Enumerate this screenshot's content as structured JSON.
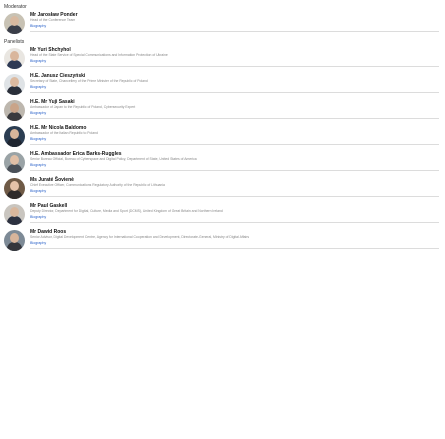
{
  "moderator": {
    "label": "Moderator",
    "entry": {
      "name": "Mr Jarosław Ponder",
      "desc": "Head of the Conference Team",
      "link": "Biography",
      "colors": {
        "bg": "#c8c2b4",
        "face": "#d8b9a0",
        "body": "#3b3f4a"
      }
    }
  },
  "panelists": {
    "label": "Panelists",
    "entries": [
      {
        "name": "Mr Yuri Shchyhol",
        "desc": "Head of the State Service of Special Communications and Information Protection of Ukraine",
        "link": "Biography",
        "colors": {
          "bg": "#e9e6e1",
          "face": "#d9b69c",
          "body": "#2e3a55"
        }
      },
      {
        "name": "H.E. Janusz Cieszyński",
        "desc": "Secretary of State, Chancellery of the Prime Minister of the Republic of Poland",
        "link": "Biography",
        "colors": {
          "bg": "#dfe3e6",
          "face": "#dcbaa0",
          "body": "#2a2f3a"
        }
      },
      {
        "name": "H.E. Mr Yuji Sasaki",
        "desc": "Ambassador of Japan to the Republic of Poland, Cybersecurity Expert",
        "link": "Biography",
        "colors": {
          "bg": "#bdb7ae",
          "face": "#c9a489",
          "body": "#3a3a3e"
        }
      },
      {
        "name": "H.E. Mr Nicola Baldomo",
        "desc": "Ambassador of the Italian Republic to Poland",
        "link": "Biography",
        "colors": {
          "bg": "#2b3d52",
          "face": "#d7b59a",
          "body": "#1f2530"
        }
      },
      {
        "name": "H.E. Ambassador Erica Barks-Ruggles",
        "desc": "Senior Bureau Official, Bureau of Cyberspace and Digital Policy, Department of State, United States of America",
        "link": "Biography",
        "colors": {
          "bg": "#9aa3a6",
          "face": "#e0bfa6",
          "body": "#4a5058"
        }
      },
      {
        "name": "Ms Juraté Šovienė",
        "desc": "Chief Executive Officer, Communications Regulatory Authority of the Republic of Lithuania",
        "link": "Biography",
        "colors": {
          "bg": "#6f5a46",
          "face": "#e4c2a8",
          "body": "#2f2b2a"
        }
      },
      {
        "name": "Mr Paul Gaskell",
        "desc": "Deputy Director, Department for Digital, Culture, Media and Sport (DCMS), United Kingdom of Great Britain and Northern Ireland",
        "link": "Biography",
        "colors": {
          "bg": "#c9c5bf",
          "face": "#d9b79d",
          "body": "#2c3140"
        }
      },
      {
        "name": "Mr Dawid Roos",
        "desc": "Senior Advisor, Digital Development Centre, Agency for International Cooperation and Development, Directorate-General, Ministry of Digital Affairs",
        "link": "Biography",
        "colors": {
          "bg": "#7d8a96",
          "face": "#d8b59b",
          "body": "#34363c"
        }
      }
    ]
  }
}
